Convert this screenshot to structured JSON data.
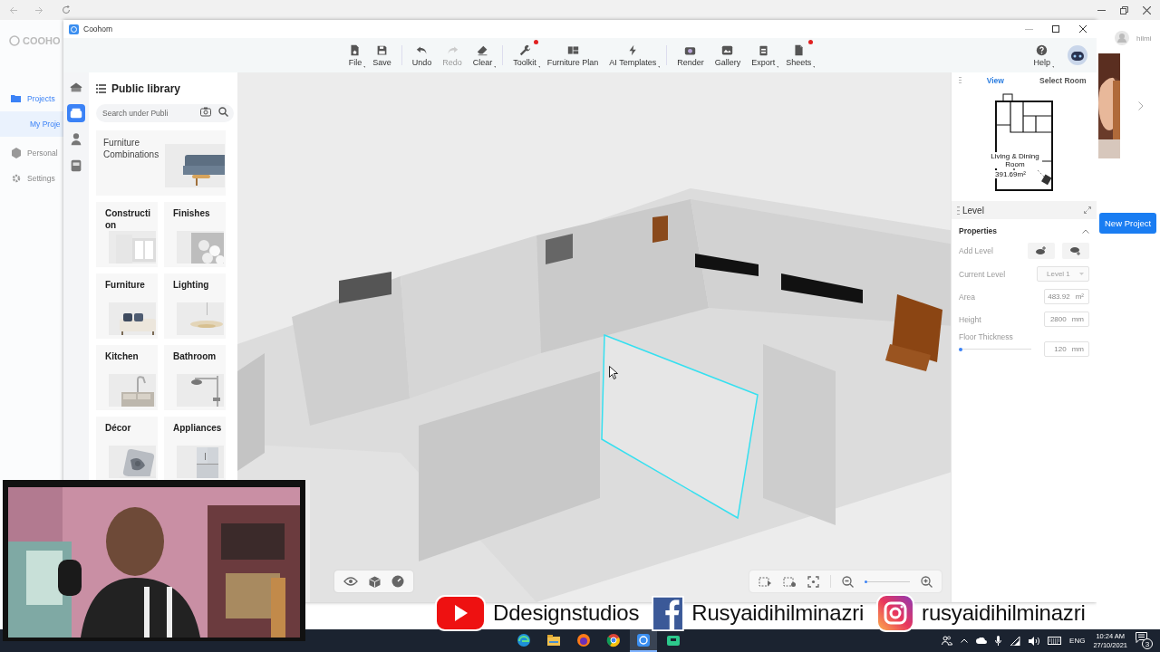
{
  "background_app": {
    "logo": "COOHO",
    "nav": [
      {
        "label": "Projects",
        "selected": true,
        "children": [
          {
            "label": "My Proje",
            "selected": true
          }
        ]
      },
      {
        "label": "Personal",
        "selected": false
      },
      {
        "label": "Settings",
        "selected": false
      }
    ],
    "user": "hilmi",
    "button": "New Project"
  },
  "window": {
    "title": "Coohom"
  },
  "toolbar": [
    {
      "label": "File",
      "disabled": false,
      "dot": false,
      "menu": true
    },
    {
      "label": "Save",
      "disabled": false,
      "dot": false,
      "menu": false
    },
    {
      "label": "Undo",
      "disabled": false,
      "dot": false,
      "menu": false
    },
    {
      "label": "Redo",
      "disabled": true,
      "dot": false,
      "menu": false
    },
    {
      "label": "Clear",
      "disabled": false,
      "dot": false,
      "menu": true
    },
    {
      "label": "Toolkit",
      "disabled": false,
      "dot": true,
      "menu": true
    },
    {
      "label": "Furniture Plan",
      "disabled": false,
      "dot": false,
      "menu": false
    },
    {
      "label": "AI Templates",
      "disabled": false,
      "dot": false,
      "menu": true
    },
    {
      "label": "Render",
      "disabled": false,
      "dot": false,
      "menu": false
    },
    {
      "label": "Gallery",
      "disabled": false,
      "dot": false,
      "menu": false
    },
    {
      "label": "Export",
      "disabled": false,
      "dot": false,
      "menu": true
    },
    {
      "label": "Sheets",
      "disabled": false,
      "dot": true,
      "menu": true
    },
    {
      "label": "Help",
      "disabled": false,
      "dot": false,
      "menu": true
    }
  ],
  "library": {
    "rail": [
      {
        "selected": false
      },
      {
        "selected": true
      },
      {
        "selected": false
      },
      {
        "selected": false
      }
    ],
    "title": "Public library",
    "search": {
      "placeholder": "Search under Publi"
    },
    "categories": [
      {
        "label": "Furniture Combinations",
        "kind": "wide"
      },
      {
        "label": "Construction",
        "kind": "tile"
      },
      {
        "label": "Finishes",
        "kind": "tile"
      },
      {
        "label": "Furniture",
        "kind": "tile"
      },
      {
        "label": "Lighting",
        "kind": "tile"
      },
      {
        "label": "Kitchen",
        "kind": "tile"
      },
      {
        "label": "Bathroom",
        "kind": "tile"
      },
      {
        "label": "Décor",
        "kind": "tile"
      },
      {
        "label": "Appliances",
        "kind": "tile"
      }
    ]
  },
  "viewport": {
    "zoom": {
      "level": 0.05
    }
  },
  "view_panel": {
    "tabs": [
      {
        "label": "View",
        "selected": true
      },
      {
        "label": "Select Room",
        "selected": false
      }
    ],
    "room": "Living & Dining Room",
    "area": "391.69m²"
  },
  "level_panel": {
    "title": "Level",
    "section": "Properties",
    "expanded": true,
    "add_label": "Add Level",
    "fields": [
      {
        "kind": "select",
        "label": "Current Level",
        "value": "Level 1",
        "disabled": true
      },
      {
        "kind": "input",
        "label": "Area",
        "value": "483.92",
        "unit": "m²",
        "disabled": false
      },
      {
        "kind": "input",
        "label": "Height",
        "value": "2800",
        "unit": "mm",
        "disabled": false
      },
      {
        "kind": "slider",
        "label": "Floor Thickness",
        "level": 0.02,
        "value": "120",
        "unit": "mm",
        "disabled": false
      }
    ]
  },
  "overlay": {
    "channels": [
      {
        "kind": "youtube",
        "handle": "Ddesignstudios"
      },
      {
        "kind": "facebook",
        "handle": "Rusyaidihilminazri"
      },
      {
        "kind": "instagram",
        "handle": "rusyaidihilminazri"
      }
    ]
  },
  "taskbar": {
    "apps": [
      {
        "active": false
      },
      {
        "active": false
      },
      {
        "active": false
      },
      {
        "active": false
      },
      {
        "active": true
      },
      {
        "active": false
      }
    ],
    "language": "ENG",
    "time": "10:24 AM",
    "date": "27/10/2021",
    "notifications": "3"
  }
}
